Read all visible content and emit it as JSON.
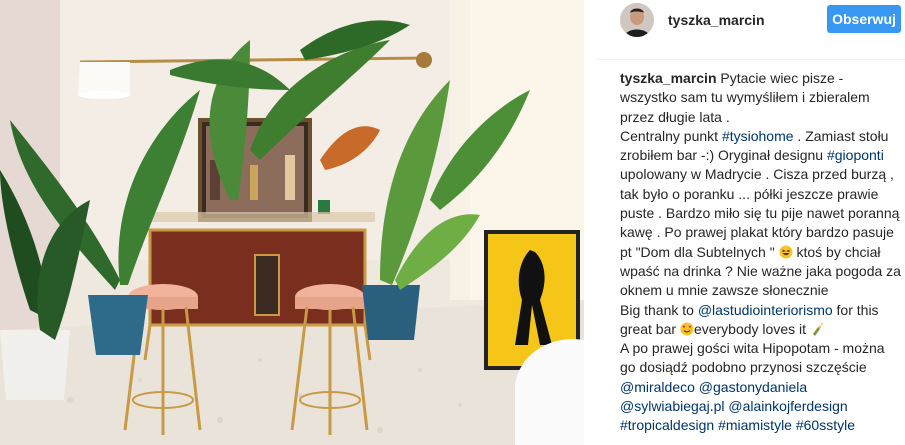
{
  "post": {
    "username": "tyszka_marcin",
    "follow_label": "Obserwuj"
  },
  "caption": {
    "author": "tyszka_marcin",
    "p1_t1": "Pytacie wiec pisze - wszystko sam tu wymyśliłem i zbieralem przez długie lata .",
    "p2_t1": "Centralny punkt ",
    "tag_tysiohome": "#tysiohome",
    "p2_t2": " . Zamiast stołu zrobiłem bar -:) Oryginał designu ",
    "tag_gioponti": "#gioponti",
    "p2_t3": " upolowany w Madrycie . Cisza przed burzą , tak było o poranku ... półki jeszcze prawie puste . Bardzo miło się tu pije nawet poranną kawę . Po prawej plakat który bardzo pasuje pt \"Dom dla Subtelnych \" ",
    "p2_t4": " ktoś by chciał wpaść na drinka ? Nie ważne jaka pogoda za oknem u mnie zawsze słonecznie",
    "p3_t1": "Big thank to ",
    "tag_lastudio": "@lastudiointeriorismo",
    "p3_t2": " for this great bar ",
    "p3_t3": "everybody loves it ",
    "p4_t1": "A po prawej gości wita Hipopotam - można go dosiądź podobno przynosi szczęście",
    "tag_miraldeco": "@miraldeco",
    "tag_gastonydaniela": "@gastonydaniela",
    "tag_sylwiabiegaj": "@sylwiabiegaj.pl",
    "tag_alainkojferdesign": "@alainkojferdesign",
    "tag_tropicaldesign": "#tropicaldesign",
    "tag_miamistyle": "#miamistyle",
    "tag_60sstyle": "#60sstyle"
  },
  "colors": {
    "follow_button": "#3897f0",
    "link": "#003569",
    "text": "#262626"
  },
  "icons": [
    "laughing-emoji-icon",
    "heart-eyes-emoji-icon",
    "champagne-bottle-icon"
  ]
}
